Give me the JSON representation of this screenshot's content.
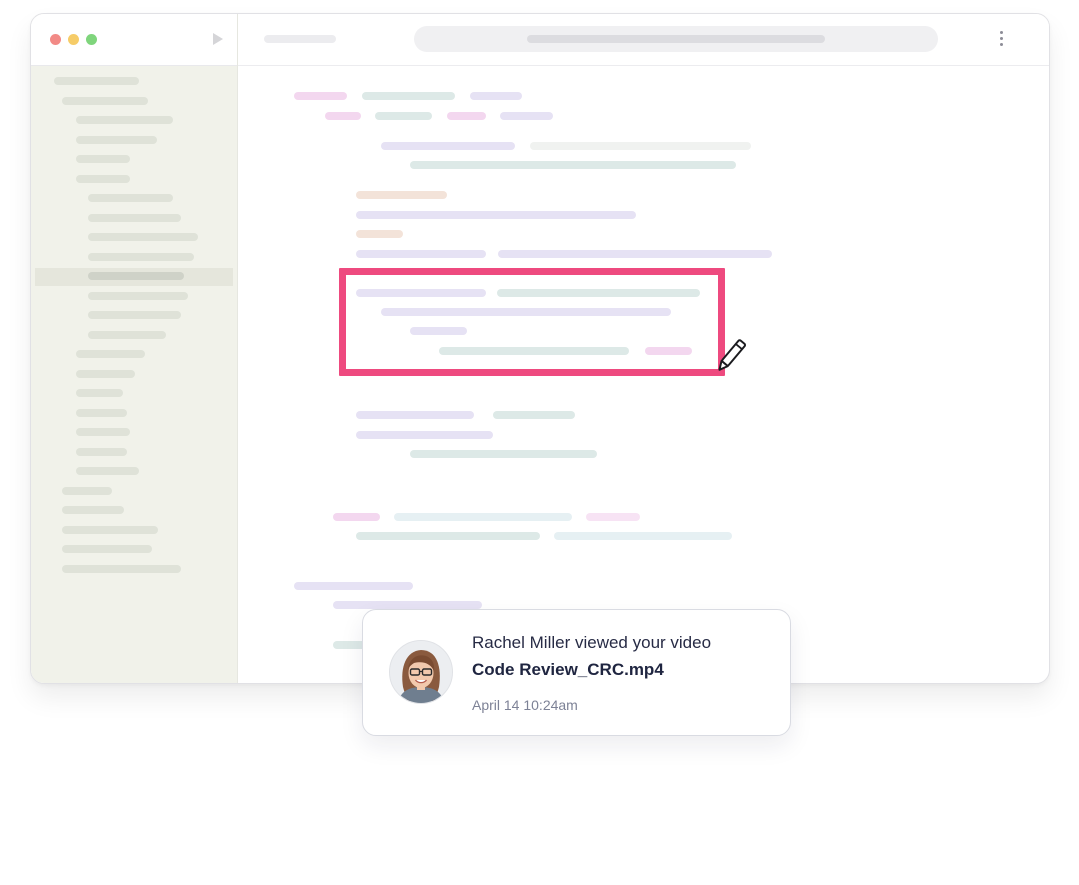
{
  "notification": {
    "message": "Rachel Miller viewed your video",
    "file_name": "Code Review_CRC.mp4",
    "timestamp": "April 14 10:24am"
  },
  "colors": {
    "highlight": "#ee4a7f",
    "sidebar_bg": "#f1f2ea",
    "dot_red": "#f28a86",
    "dot_yellow": "#f6cc68",
    "dot_green": "#7fd57c"
  },
  "icons": [
    "close-dot",
    "minimize-dot",
    "maximize-dot",
    "play-icon",
    "kebab-menu-icon",
    "pencil-icon",
    "avatar"
  ]
}
